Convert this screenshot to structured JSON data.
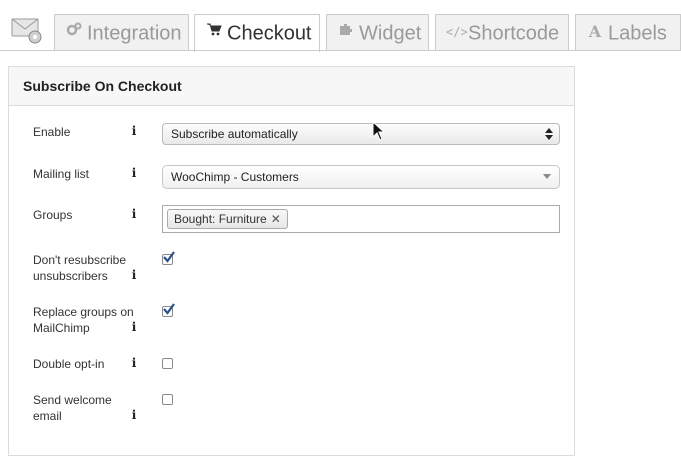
{
  "tabs": [
    {
      "label": "Integration",
      "icon": "gears-icon",
      "active": false
    },
    {
      "label": "Checkout",
      "icon": "cart-icon",
      "active": true
    },
    {
      "label": "Widget",
      "icon": "puzzle-icon",
      "active": false
    },
    {
      "label": "Shortcode",
      "icon": "code-icon",
      "active": false
    },
    {
      "label": "Labels",
      "icon": "letter-a-icon",
      "active": false
    }
  ],
  "panel": {
    "title": "Subscribe On Checkout",
    "fields": {
      "enable": {
        "label": "Enable",
        "value": "Subscribe automatically"
      },
      "mailing_list": {
        "label": "Mailing list",
        "value": "WooChimp - Customers"
      },
      "groups": {
        "label": "Groups",
        "chips": [
          "Bought: Furniture"
        ]
      },
      "dont_resubscribe": {
        "label_line1": "Don't resubscribe",
        "label_line2": "unsubscribers",
        "checked": true
      },
      "replace_groups": {
        "label_line1": "Replace groups on",
        "label_line2": "MailChimp",
        "checked": true
      },
      "double_optin": {
        "label": "Double opt-in",
        "checked": false
      },
      "send_welcome": {
        "label_line1": "Send welcome",
        "label_line2": "email",
        "checked": false
      }
    },
    "info_glyph": "i"
  },
  "colors": {
    "check": "#2a4f8a",
    "tab_inactive_text": "#9a9a9a",
    "border": "#cccccc"
  }
}
